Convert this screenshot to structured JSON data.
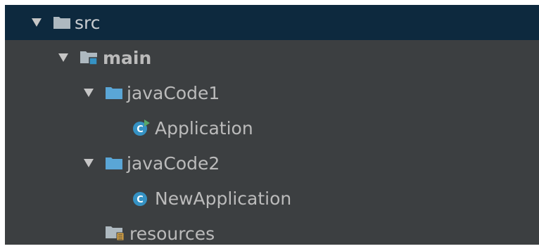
{
  "project_tree": {
    "items": [
      {
        "label": "src",
        "icon": "folder-icon",
        "expanded": true,
        "selected": true
      },
      {
        "label": "main",
        "icon": "source-root-folder-icon",
        "expanded": true,
        "selected": false
      },
      {
        "label": "javaCode1",
        "icon": "package-folder-icon",
        "expanded": true,
        "selected": false
      },
      {
        "label": "Application",
        "icon": "runnable-class-icon",
        "selected": false
      },
      {
        "label": "javaCode2",
        "icon": "package-folder-icon",
        "expanded": true,
        "selected": false
      },
      {
        "label": "NewApplication",
        "icon": "class-icon",
        "selected": false
      },
      {
        "label": "resources",
        "icon": "resources-folder-icon",
        "selected": false
      }
    ]
  },
  "colors": {
    "background": "#3c3f41",
    "selection": "#0d293e",
    "text": "#bbbbbb",
    "folder": "#aeb9c0",
    "package_folder": "#5aa6d6",
    "class_icon": "#3592c4",
    "run_marker": "#59a869",
    "resources_marker": "#d9a343"
  }
}
